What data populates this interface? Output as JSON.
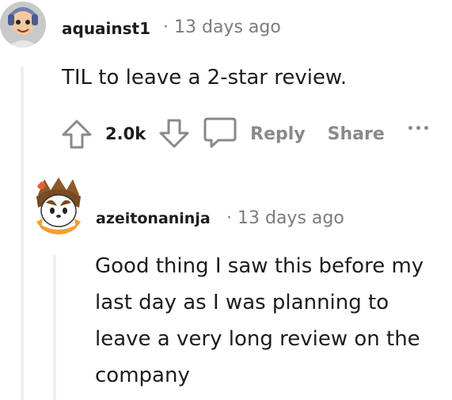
{
  "comments": [
    {
      "username": "aquainst1",
      "meta": "· 13 days ago",
      "body": "TIL to leave a 2-star review.",
      "score": "2.0k",
      "reply_label": "Reply",
      "share_label": "Share"
    },
    {
      "username": "azeitonaninja",
      "meta": "· 13 days ago",
      "body": "Good thing I saw this before my last day as I was planning to leave a very long review on the company"
    }
  ],
  "colors": {
    "text": "#1c1c1c",
    "muted": "#7c7c7c",
    "action": "#878a8c",
    "thread_line": "#edeff1"
  },
  "icons": [
    "avatar",
    "upvote-icon",
    "downvote-icon",
    "comment-bubble-icon",
    "more-options-icon"
  ]
}
